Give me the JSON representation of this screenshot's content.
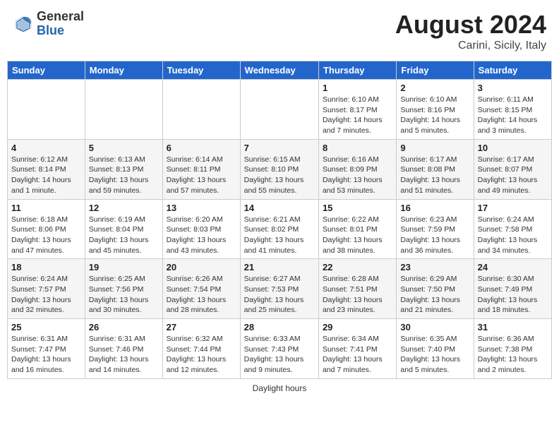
{
  "header": {
    "logo_general": "General",
    "logo_blue": "Blue",
    "month_title": "August 2024",
    "location": "Carini, Sicily, Italy"
  },
  "footer": {
    "label": "Daylight hours"
  },
  "weekdays": [
    "Sunday",
    "Monday",
    "Tuesday",
    "Wednesday",
    "Thursday",
    "Friday",
    "Saturday"
  ],
  "weeks": [
    [
      {
        "day": "",
        "info": ""
      },
      {
        "day": "",
        "info": ""
      },
      {
        "day": "",
        "info": ""
      },
      {
        "day": "",
        "info": ""
      },
      {
        "day": "1",
        "info": "Sunrise: 6:10 AM\nSunset: 8:17 PM\nDaylight: 14 hours\nand 7 minutes."
      },
      {
        "day": "2",
        "info": "Sunrise: 6:10 AM\nSunset: 8:16 PM\nDaylight: 14 hours\nand 5 minutes."
      },
      {
        "day": "3",
        "info": "Sunrise: 6:11 AM\nSunset: 8:15 PM\nDaylight: 14 hours\nand 3 minutes."
      }
    ],
    [
      {
        "day": "4",
        "info": "Sunrise: 6:12 AM\nSunset: 8:14 PM\nDaylight: 14 hours\nand 1 minute."
      },
      {
        "day": "5",
        "info": "Sunrise: 6:13 AM\nSunset: 8:13 PM\nDaylight: 13 hours\nand 59 minutes."
      },
      {
        "day": "6",
        "info": "Sunrise: 6:14 AM\nSunset: 8:11 PM\nDaylight: 13 hours\nand 57 minutes."
      },
      {
        "day": "7",
        "info": "Sunrise: 6:15 AM\nSunset: 8:10 PM\nDaylight: 13 hours\nand 55 minutes."
      },
      {
        "day": "8",
        "info": "Sunrise: 6:16 AM\nSunset: 8:09 PM\nDaylight: 13 hours\nand 53 minutes."
      },
      {
        "day": "9",
        "info": "Sunrise: 6:17 AM\nSunset: 8:08 PM\nDaylight: 13 hours\nand 51 minutes."
      },
      {
        "day": "10",
        "info": "Sunrise: 6:17 AM\nSunset: 8:07 PM\nDaylight: 13 hours\nand 49 minutes."
      }
    ],
    [
      {
        "day": "11",
        "info": "Sunrise: 6:18 AM\nSunset: 8:06 PM\nDaylight: 13 hours\nand 47 minutes."
      },
      {
        "day": "12",
        "info": "Sunrise: 6:19 AM\nSunset: 8:04 PM\nDaylight: 13 hours\nand 45 minutes."
      },
      {
        "day": "13",
        "info": "Sunrise: 6:20 AM\nSunset: 8:03 PM\nDaylight: 13 hours\nand 43 minutes."
      },
      {
        "day": "14",
        "info": "Sunrise: 6:21 AM\nSunset: 8:02 PM\nDaylight: 13 hours\nand 41 minutes."
      },
      {
        "day": "15",
        "info": "Sunrise: 6:22 AM\nSunset: 8:01 PM\nDaylight: 13 hours\nand 38 minutes."
      },
      {
        "day": "16",
        "info": "Sunrise: 6:23 AM\nSunset: 7:59 PM\nDaylight: 13 hours\nand 36 minutes."
      },
      {
        "day": "17",
        "info": "Sunrise: 6:24 AM\nSunset: 7:58 PM\nDaylight: 13 hours\nand 34 minutes."
      }
    ],
    [
      {
        "day": "18",
        "info": "Sunrise: 6:24 AM\nSunset: 7:57 PM\nDaylight: 13 hours\nand 32 minutes."
      },
      {
        "day": "19",
        "info": "Sunrise: 6:25 AM\nSunset: 7:56 PM\nDaylight: 13 hours\nand 30 minutes."
      },
      {
        "day": "20",
        "info": "Sunrise: 6:26 AM\nSunset: 7:54 PM\nDaylight: 13 hours\nand 28 minutes."
      },
      {
        "day": "21",
        "info": "Sunrise: 6:27 AM\nSunset: 7:53 PM\nDaylight: 13 hours\nand 25 minutes."
      },
      {
        "day": "22",
        "info": "Sunrise: 6:28 AM\nSunset: 7:51 PM\nDaylight: 13 hours\nand 23 minutes."
      },
      {
        "day": "23",
        "info": "Sunrise: 6:29 AM\nSunset: 7:50 PM\nDaylight: 13 hours\nand 21 minutes."
      },
      {
        "day": "24",
        "info": "Sunrise: 6:30 AM\nSunset: 7:49 PM\nDaylight: 13 hours\nand 18 minutes."
      }
    ],
    [
      {
        "day": "25",
        "info": "Sunrise: 6:31 AM\nSunset: 7:47 PM\nDaylight: 13 hours\nand 16 minutes."
      },
      {
        "day": "26",
        "info": "Sunrise: 6:31 AM\nSunset: 7:46 PM\nDaylight: 13 hours\nand 14 minutes."
      },
      {
        "day": "27",
        "info": "Sunrise: 6:32 AM\nSunset: 7:44 PM\nDaylight: 13 hours\nand 12 minutes."
      },
      {
        "day": "28",
        "info": "Sunrise: 6:33 AM\nSunset: 7:43 PM\nDaylight: 13 hours\nand 9 minutes."
      },
      {
        "day": "29",
        "info": "Sunrise: 6:34 AM\nSunset: 7:41 PM\nDaylight: 13 hours\nand 7 minutes."
      },
      {
        "day": "30",
        "info": "Sunrise: 6:35 AM\nSunset: 7:40 PM\nDaylight: 13 hours\nand 5 minutes."
      },
      {
        "day": "31",
        "info": "Sunrise: 6:36 AM\nSunset: 7:38 PM\nDaylight: 13 hours\nand 2 minutes."
      }
    ]
  ]
}
